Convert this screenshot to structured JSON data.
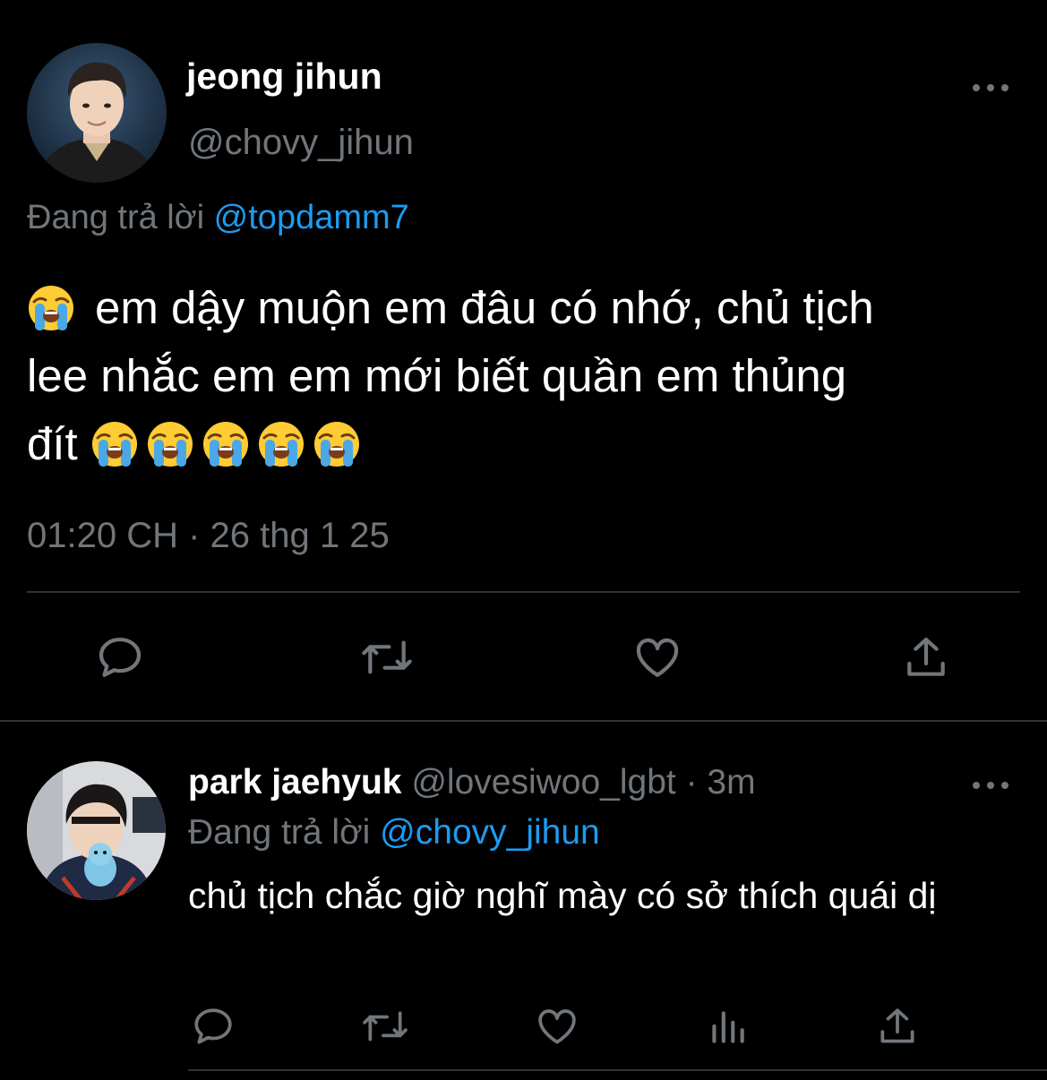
{
  "colors": {
    "background": "#000000",
    "text": "#ffffff",
    "muted": "#71767b",
    "accent": "#1d9bf0",
    "divider": "#2f3336"
  },
  "main_tweet": {
    "display_name": "jeong jihun",
    "handle": "@chovy_jihun",
    "replying_prefix": "Đang trả lời",
    "replying_to": "@topdamm7",
    "text_line1": "em dậy muộn em đâu có nhớ, chủ tịch",
    "text_line2": "lee nhắc em em mới biết quần em thủng",
    "text_line3": "đít",
    "leading_emoji": "loudly-crying-face-emoji",
    "trailing_emoji_count": 5,
    "timestamp": "01:20 CH · 26 thg 1 25",
    "actions": [
      "reply-icon",
      "retweet-icon",
      "like-icon",
      "share-icon"
    ]
  },
  "reply_tweet": {
    "display_name": "park jaehyuk",
    "handle": "@lovesiwoo_lgbt",
    "separator": " · ",
    "time": "3m",
    "replying_prefix": "Đang trả lời",
    "replying_to": "@chovy_jihun",
    "text": "chủ tịch chắc giờ nghĩ mày có sở thích quái dị",
    "actions": [
      "reply-icon",
      "retweet-icon",
      "like-icon",
      "analytics-icon",
      "share-icon"
    ]
  }
}
